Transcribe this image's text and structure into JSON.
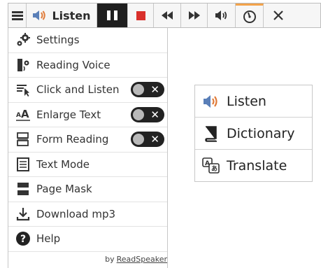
{
  "toolbar": {
    "listen_label": "Listen",
    "buttons": [
      "menu-icon",
      "listen",
      "pause-icon",
      "stop-icon",
      "rewind-icon",
      "fast-forward-icon",
      "volume-icon",
      "speed-icon",
      "close-icon"
    ],
    "accent_color": "#f2a24a"
  },
  "menu": {
    "items": [
      {
        "label": "Settings",
        "icon": "gears-icon"
      },
      {
        "label": "Reading Voice",
        "icon": "voice-icon"
      },
      {
        "label": "Click and Listen",
        "icon": "click-listen-icon",
        "toggle": false
      },
      {
        "label": "Enlarge Text",
        "icon": "enlarge-text-icon",
        "toggle": false
      },
      {
        "label": "Form Reading",
        "icon": "form-reading-icon",
        "toggle": false
      },
      {
        "label": "Text Mode",
        "icon": "text-mode-icon"
      },
      {
        "label": "Page Mask",
        "icon": "page-mask-icon"
      },
      {
        "label": "Download mp3",
        "icon": "download-icon"
      },
      {
        "label": "Help",
        "icon": "help-icon"
      }
    ],
    "toggle_off_symbol": "✕",
    "by_prefix": "by",
    "brand": "ReadSpeaker"
  },
  "popup": {
    "items": [
      {
        "label": "Listen",
        "icon": "speaker-icon"
      },
      {
        "label": "Dictionary",
        "icon": "book-icon"
      },
      {
        "label": "Translate",
        "icon": "translate-icon"
      }
    ]
  }
}
